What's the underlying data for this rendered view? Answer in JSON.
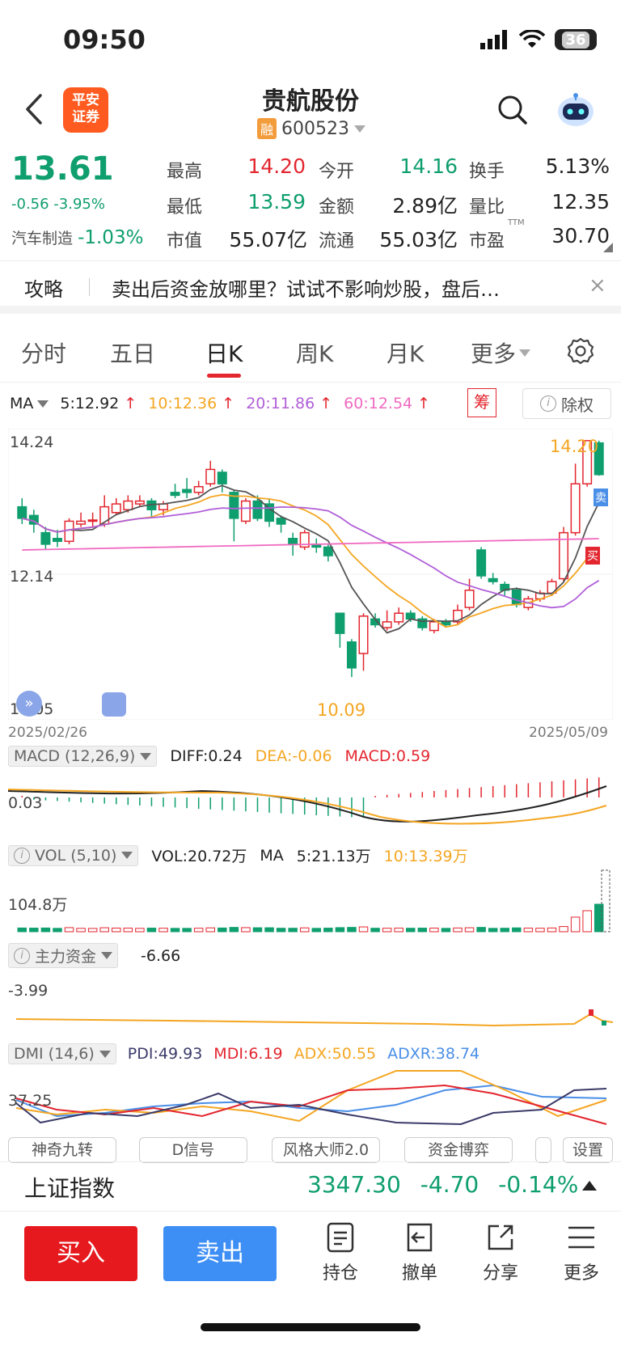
{
  "status": {
    "time": "09:50",
    "battery": "36"
  },
  "header": {
    "logo_line1": "平安",
    "logo_line2": "证券",
    "title": "贵航股份",
    "margin_tag": "融",
    "code": "600523"
  },
  "quote": {
    "price": "13.61",
    "change": "-0.56 -3.95%",
    "sector_name": "汽车制造",
    "sector_change": "-1.03%",
    "fields": [
      {
        "label": "最高",
        "value": "14.20"
      },
      {
        "label": "今开",
        "value": "14.16"
      },
      {
        "label": "换手",
        "value": "5.13%"
      },
      {
        "label": "最低",
        "value": "13.59"
      },
      {
        "label": "金额",
        "value": "2.89亿"
      },
      {
        "label": "量比",
        "value": "12.35"
      },
      {
        "label": "市值",
        "value": "55.07亿"
      },
      {
        "label": "流通",
        "value": "55.03亿"
      },
      {
        "label": "市盈",
        "value": "30.70"
      }
    ],
    "pe_sup": "TTM"
  },
  "promo": {
    "tag": "攻略",
    "text": "卖出后资金放哪里？试试不影响炒股，盘后…",
    "close": "×"
  },
  "tabs": [
    "分时",
    "五日",
    "日K",
    "周K",
    "月K",
    "更多"
  ],
  "ma": {
    "label": "MA",
    "ma5": "5:12.92",
    "ma10": "10:12.36",
    "ma20": "20:11.86",
    "ma60": "60:12.54",
    "chou": "筹",
    "chuquan": "除权"
  },
  "kchart": {
    "y_top": "14.24",
    "y_mid": "12.14",
    "y_bottom": "10.05",
    "high_label": "14.20",
    "low_label": "10.09",
    "date_start": "2025/02/26",
    "date_end": "2025/05/09",
    "sell_mark": "卖",
    "buy_mark": "买"
  },
  "macd": {
    "label": "MACD (12,26,9)",
    "diff": "DIFF:0.24",
    "dea": "DEA:-0.06",
    "macd": "MACD:0.59",
    "axis": "0.03"
  },
  "vol": {
    "label": "VOL (5,10)",
    "vol": "VOL:20.72万",
    "ma": "MA",
    "ma5": "5:21.13万",
    "ma10": "10:13.39万",
    "axis": "104.8万"
  },
  "fund": {
    "label": "主力资金",
    "value": "-6.66",
    "axis": "-3.99"
  },
  "dmi": {
    "label": "DMI (14,6)",
    "pdi": "PDI:49.93",
    "mdi": "MDI:6.19",
    "adx": "ADX:50.55",
    "adxr": "ADXR:38.74",
    "axis": "37.25"
  },
  "pills": [
    "神奇九转",
    "D信号",
    "风格大师2.0",
    "资金博弈",
    "",
    "设置"
  ],
  "index": {
    "name": "上证指数",
    "value": "3347.30",
    "change": "-4.70",
    "pct": "-0.14%"
  },
  "bottom": {
    "buy": "买入",
    "sell": "卖出",
    "tools": [
      "持仓",
      "撤单",
      "分享",
      "更多"
    ]
  },
  "chart_data": {
    "type": "candlestick",
    "title": "",
    "x_range": [
      "2025/02/26",
      "2025/05/09"
    ],
    "y_ticks": [
      14.24,
      12.14,
      10.05
    ],
    "ylim": [
      10.05,
      14.24
    ],
    "candles": [
      {
        "o": 13.05,
        "c": 12.85,
        "h": 13.2,
        "l": 12.75
      },
      {
        "o": 12.9,
        "c": 12.75,
        "h": 13.0,
        "l": 12.6
      },
      {
        "o": 12.6,
        "c": 12.4,
        "h": 12.7,
        "l": 12.3
      },
      {
        "o": 12.5,
        "c": 12.45,
        "h": 12.65,
        "l": 12.35
      },
      {
        "o": 12.45,
        "c": 12.8,
        "h": 12.85,
        "l": 12.4
      },
      {
        "o": 12.75,
        "c": 12.8,
        "h": 12.95,
        "l": 12.7
      },
      {
        "o": 12.8,
        "c": 12.82,
        "h": 12.95,
        "l": 12.7
      },
      {
        "o": 12.75,
        "c": 13.05,
        "h": 13.25,
        "l": 12.7
      },
      {
        "o": 12.95,
        "c": 13.1,
        "h": 13.2,
        "l": 12.9
      },
      {
        "o": 13.0,
        "c": 13.15,
        "h": 13.25,
        "l": 12.95
      },
      {
        "o": 13.1,
        "c": 13.15,
        "h": 13.25,
        "l": 13.05
      },
      {
        "o": 13.15,
        "c": 13.0,
        "h": 13.2,
        "l": 12.85
      },
      {
        "o": 13.0,
        "c": 13.1,
        "h": 13.15,
        "l": 12.9
      },
      {
        "o": 13.3,
        "c": 13.25,
        "h": 13.45,
        "l": 13.2
      },
      {
        "o": 13.35,
        "c": 13.3,
        "h": 13.55,
        "l": 13.2
      },
      {
        "o": 13.3,
        "c": 13.4,
        "h": 13.5,
        "l": 13.25
      },
      {
        "o": 13.45,
        "c": 13.7,
        "h": 13.85,
        "l": 13.4
      },
      {
        "o": 13.65,
        "c": 13.45,
        "h": 13.7,
        "l": 13.3
      },
      {
        "o": 13.3,
        "c": 12.85,
        "h": 13.35,
        "l": 12.45
      },
      {
        "o": 12.8,
        "c": 13.15,
        "h": 13.2,
        "l": 12.75
      },
      {
        "o": 13.15,
        "c": 12.85,
        "h": 13.25,
        "l": 12.8
      },
      {
        "o": 13.1,
        "c": 12.8,
        "h": 13.2,
        "l": 12.7
      },
      {
        "o": 12.85,
        "c": 12.75,
        "h": 12.9,
        "l": 12.6
      },
      {
        "o": 12.5,
        "c": 12.4,
        "h": 12.6,
        "l": 12.2
      },
      {
        "o": 12.35,
        "c": 12.6,
        "h": 12.65,
        "l": 12.3
      },
      {
        "o": 12.4,
        "c": 12.35,
        "h": 12.5,
        "l": 12.25
      },
      {
        "o": 12.35,
        "c": 12.2,
        "h": 12.4,
        "l": 12.1
      },
      {
        "o": 11.2,
        "c": 10.85,
        "h": 11.2,
        "l": 10.6
      },
      {
        "o": 10.7,
        "c": 10.25,
        "h": 10.75,
        "l": 10.09
      },
      {
        "o": 10.5,
        "c": 11.15,
        "h": 11.2,
        "l": 10.2
      },
      {
        "o": 11.1,
        "c": 11.0,
        "h": 11.2,
        "l": 10.95
      },
      {
        "o": 10.95,
        "c": 11.05,
        "h": 11.25,
        "l": 10.9
      },
      {
        "o": 11.05,
        "c": 11.2,
        "h": 11.3,
        "l": 11.0
      },
      {
        "o": 11.2,
        "c": 11.1,
        "h": 11.25,
        "l": 11.05
      },
      {
        "o": 11.1,
        "c": 10.95,
        "h": 11.15,
        "l": 10.9
      },
      {
        "o": 10.9,
        "c": 11.05,
        "h": 11.1,
        "l": 10.85
      },
      {
        "o": 11.05,
        "c": 11.0,
        "h": 11.1,
        "l": 10.95
      },
      {
        "o": 11.05,
        "c": 11.25,
        "h": 11.35,
        "l": 11.0
      },
      {
        "o": 11.3,
        "c": 11.6,
        "h": 11.8,
        "l": 11.25
      },
      {
        "o": 12.3,
        "c": 11.85,
        "h": 12.35,
        "l": 11.8
      },
      {
        "o": 11.8,
        "c": 11.75,
        "h": 11.9,
        "l": 11.7
      },
      {
        "o": 11.7,
        "c": 11.6,
        "h": 11.75,
        "l": 11.5
      },
      {
        "o": 11.6,
        "c": 11.35,
        "h": 11.65,
        "l": 11.3
      },
      {
        "o": 11.3,
        "c": 11.45,
        "h": 11.5,
        "l": 11.25
      },
      {
        "o": 11.45,
        "c": 11.55,
        "h": 11.6,
        "l": 11.4
      },
      {
        "o": 11.55,
        "c": 11.75,
        "h": 11.8,
        "l": 11.5
      },
      {
        "o": 11.8,
        "c": 12.6,
        "h": 12.7,
        "l": 11.75
      },
      {
        "o": 12.6,
        "c": 13.45,
        "h": 13.8,
        "l": 12.55
      },
      {
        "o": 13.45,
        "c": 14.2,
        "h": 14.2,
        "l": 13.4
      },
      {
        "o": 14.16,
        "c": 13.61,
        "h": 14.2,
        "l": 13.59
      }
    ],
    "ma": [
      {
        "name": "MA5",
        "color": "#555555"
      },
      {
        "name": "MA10",
        "color": "#f4a622"
      },
      {
        "name": "MA20",
        "color": "#b15fd8"
      },
      {
        "name": "MA60",
        "color": "#f06ac1"
      }
    ]
  },
  "colors": {
    "up": "#e3262f",
    "down": "#0f9e6e",
    "accent": "#3d8ef5"
  }
}
